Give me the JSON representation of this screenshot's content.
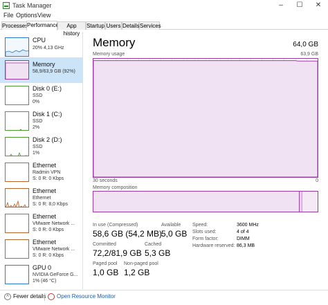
{
  "window": {
    "title": "Task Manager",
    "minimize": "–",
    "maximize": "☐",
    "close": "✕"
  },
  "menu": [
    "File",
    "Options",
    "View"
  ],
  "tabs": [
    "Processes",
    "Performance",
    "App history",
    "Startup",
    "Users",
    "Details",
    "Services"
  ],
  "active_tab": "Performance",
  "sidebar": [
    {
      "title": "CPU",
      "sub1": "20%  4,13 GHz",
      "sub2": "",
      "color": "#2b7dc9"
    },
    {
      "title": "Memory",
      "sub1": "58,9/63,9 GB (92%)",
      "sub2": "",
      "color": "#9d3aa8"
    },
    {
      "title": "Disk 0 (E:)",
      "sub1": "SSD",
      "sub2": "0%",
      "color": "#4c9d2f"
    },
    {
      "title": "Disk 1 (C:)",
      "sub1": "SSD",
      "sub2": "2%",
      "color": "#4c9d2f"
    },
    {
      "title": "Disk 2 (D:)",
      "sub1": "SSD",
      "sub2": "1%",
      "color": "#4c9d2f"
    },
    {
      "title": "Ethernet",
      "sub1": "Radmin VPN",
      "sub2": "S: 0 R: 0 Kbps",
      "color": "#b9642a"
    },
    {
      "title": "Ethernet",
      "sub1": "Ethernet",
      "sub2": "S: 0 R: 8,0 Kbps",
      "color": "#b9642a"
    },
    {
      "title": "Ethernet",
      "sub1": "VMware Network ...",
      "sub2": "S: 0 R: 0 Kbps",
      "color": "#b9642a"
    },
    {
      "title": "Ethernet",
      "sub1": "VMware Network ...",
      "sub2": "S: 0 R: 0 Kbps",
      "color": "#b9642a"
    },
    {
      "title": "GPU 0",
      "sub1": "NVIDIA GeForce G...",
      "sub2": "1% (46 °C)",
      "color": "#2b7dc9"
    }
  ],
  "main": {
    "title": "Memory",
    "total": "64,0 GB",
    "usage_label": "Memory usage",
    "usage_max": "63,9 GB",
    "time_left": "30 seconds",
    "time_right": "0",
    "composition_label": "Memory composition",
    "usage_level": 0.92,
    "composition_in_use_fraction": 0.92
  },
  "stats": {
    "in_use_label": "In use (Compressed)",
    "in_use_value": "58,6 GB (54,2 MB)",
    "available_label": "Available",
    "available_value": "5,0 GB",
    "committed_label": "Committed",
    "committed_value": "72,2/81,9 GB",
    "cached_label": "Cached",
    "cached_value": "5,3 GB",
    "paged_label": "Paged pool",
    "paged_value": "1,0 GB",
    "nonpaged_label": "Non-paged pool",
    "nonpaged_value": "1,2 GB"
  },
  "details": [
    {
      "label": "Speed:",
      "value": "3600 MHz"
    },
    {
      "label": "Slots used:",
      "value": "4 of 4"
    },
    {
      "label": "Form factor:",
      "value": "DIMM"
    },
    {
      "label": "Hardware reserved:",
      "value": "86,3 MB"
    }
  ],
  "footer": {
    "fewer_details": "Fewer details",
    "open_rm": "Open Resource Monitor"
  }
}
